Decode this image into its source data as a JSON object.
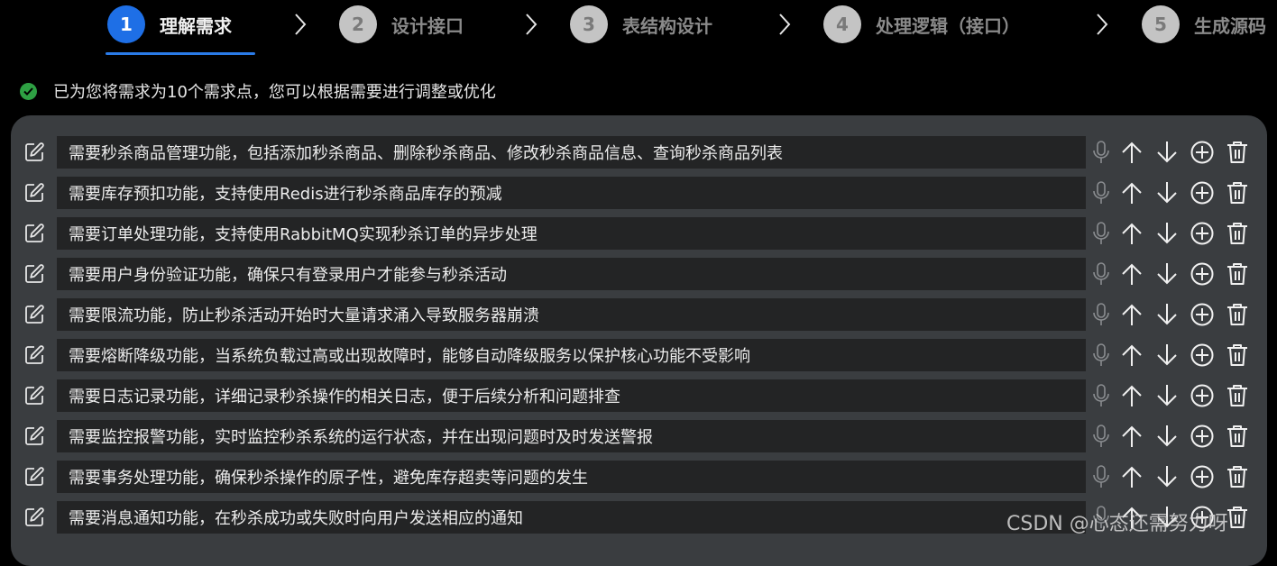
{
  "stepper": {
    "steps": [
      {
        "num": "1",
        "label": "理解需求",
        "active": true
      },
      {
        "num": "2",
        "label": "设计接口",
        "active": false
      },
      {
        "num": "3",
        "label": "表结构设计",
        "active": false
      },
      {
        "num": "4",
        "label": "处理逻辑（接口）",
        "active": false
      },
      {
        "num": "5",
        "label": "生成源码",
        "active": false
      }
    ]
  },
  "notice": {
    "text": "已为您将需求为10个需求点，您可以根据需要进行调整或优化",
    "icon": "check-circle-icon"
  },
  "requirements": [
    "需要秒杀商品管理功能，包括添加秒杀商品、删除秒杀商品、修改秒杀商品信息、查询秒杀商品列表",
    "需要库存预扣功能，支持使用Redis进行秒杀商品库存的预减",
    "需要订单处理功能，支持使用RabbitMQ实现秒杀订单的异步处理",
    "需要用户身份验证功能，确保只有登录用户才能参与秒杀活动",
    "需要限流功能，防止秒杀活动开始时大量请求涌入导致服务器崩溃",
    "需要熔断降级功能，当系统负载过高或出现故障时，能够自动降级服务以保护核心功能不受影响",
    "需要日志记录功能，详细记录秒杀操作的相关日志，便于后续分析和问题排查",
    "需要监控报警功能，实时监控秒杀系统的运行状态，并在出现问题时及时发送警报",
    "需要事务处理功能，确保秒杀操作的原子性，避免库存超卖等问题的发生",
    "需要消息通知功能，在秒杀成功或失败时向用户发送相应的通知"
  ],
  "row_icons": [
    "edit-icon",
    "microphone-icon",
    "arrow-up-icon",
    "arrow-down-icon",
    "plus-circle-icon",
    "trash-icon"
  ],
  "watermark": "CSDN @心态还需努力呀",
  "colors": {
    "accent": "#1e6fe6",
    "success": "#2ea043",
    "panel": "#3a3d40",
    "field": "#232425",
    "background": "#000000"
  }
}
